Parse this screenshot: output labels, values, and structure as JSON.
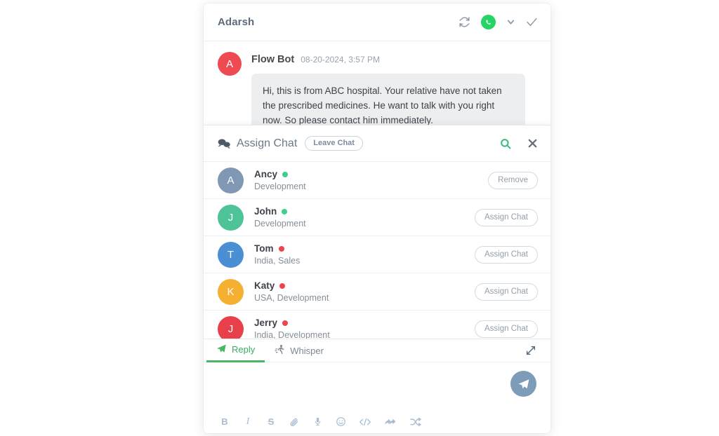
{
  "header": {
    "title": "Adarsh",
    "icons": [
      {
        "name": "refresh-icon",
        "label": "Refresh"
      },
      {
        "name": "whatsapp-icon",
        "label": "WhatsApp"
      },
      {
        "name": "chevron-down-icon",
        "label": "More channels"
      },
      {
        "name": "check-icon",
        "label": "Resolve"
      }
    ]
  },
  "conversation": {
    "message": {
      "avatar_initial": "A",
      "avatar_color": "#ef4a52",
      "sender": "Flow Bot",
      "timestamp": "08-20-2024, 3:57 PM",
      "text": "Hi, this is from ABC hospital. Your relative have not taken the prescribed medicines. He want to talk with you right now. So please contact him immediately."
    }
  },
  "assign_panel": {
    "title": "Assign Chat",
    "leave_chat_label": "Leave Chat",
    "search_label": "Search",
    "close_label": "Close",
    "agents": [
      {
        "initial": "A",
        "name": "Ancy",
        "department": "Development",
        "status": "online",
        "status_color": "#3ecf8e",
        "avatar_color": "#8098b3",
        "action": "Remove"
      },
      {
        "initial": "J",
        "name": "John",
        "department": "Development",
        "status": "online",
        "status_color": "#3ecf8e",
        "avatar_color": "#4ec397",
        "action": "Assign Chat"
      },
      {
        "initial": "T",
        "name": "Tom",
        "department": "India, Sales",
        "status": "offline",
        "status_color": "#f0444c",
        "avatar_color": "#4a8fd4",
        "action": "Assign Chat"
      },
      {
        "initial": "K",
        "name": "Katy",
        "department": "USA, Development",
        "status": "offline",
        "status_color": "#f0444c",
        "avatar_color": "#f5b032",
        "action": "Assign Chat"
      },
      {
        "initial": "J",
        "name": "Jerry",
        "department": "India, Development",
        "status": "offline",
        "status_color": "#f0444c",
        "avatar_color": "#e8404a",
        "action": "Assign Chat"
      }
    ]
  },
  "composer": {
    "tabs": [
      {
        "label": "Reply",
        "icon": "paper-plane-icon",
        "active": true
      },
      {
        "label": "Whisper",
        "icon": "running-person-icon",
        "active": false
      }
    ],
    "expand_label": "Expand",
    "input_value": "",
    "input_placeholder": "",
    "send_label": "Send",
    "accent_color": "#48b764",
    "send_button_color": "#7d9cb8",
    "format_tools": [
      {
        "name": "bold-icon",
        "glyph": "B"
      },
      {
        "name": "italic-icon",
        "glyph": "I"
      },
      {
        "name": "strikethrough-icon",
        "glyph": "S"
      },
      {
        "name": "attachment-icon",
        "glyph": ""
      },
      {
        "name": "microphone-icon",
        "glyph": ""
      },
      {
        "name": "emoji-icon",
        "glyph": ""
      },
      {
        "name": "code-icon",
        "glyph": "</>"
      },
      {
        "name": "reply-all-icon",
        "glyph": ""
      },
      {
        "name": "shuffle-icon",
        "glyph": ""
      }
    ]
  }
}
